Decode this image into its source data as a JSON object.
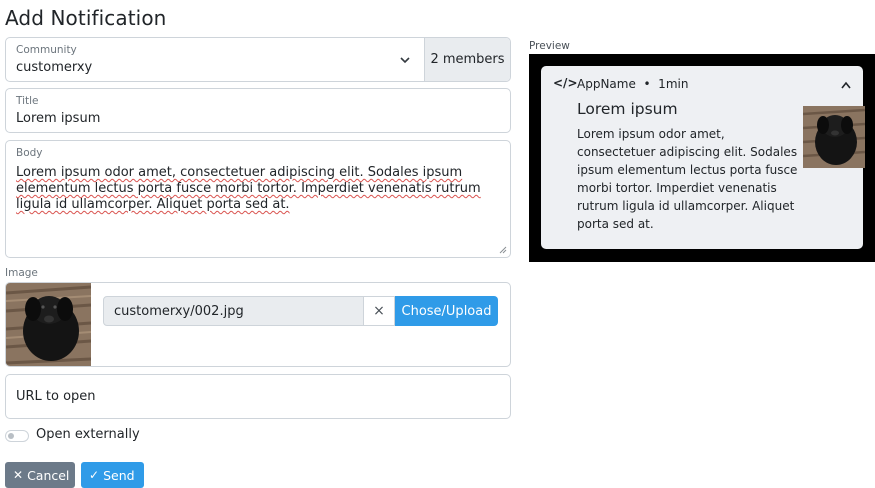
{
  "page": {
    "title": "Add Notification"
  },
  "community": {
    "label": "Community",
    "value": "customerxy",
    "members": "2 members"
  },
  "title_field": {
    "label": "Title",
    "value": "Lorem ipsum"
  },
  "body_field": {
    "label": "Body",
    "value": "Lorem ipsum odor amet, consectetuer adipiscing elit. Sodales ipsum elementum lectus porta fusce morbi tortor. Imperdiet venenatis rutrum ligula id ullamcorper. Aliquet porta sed at."
  },
  "image": {
    "label": "Image",
    "file": "customerxy/002.jpg",
    "upload_label": "Chose/Upload",
    "clear_symbol": "×"
  },
  "url_field": {
    "placeholder": "URL to open"
  },
  "open_externally": {
    "label": "Open externally",
    "checked": false
  },
  "actions": {
    "cancel_label": "Cancel",
    "send_label": "Send"
  },
  "preview": {
    "label": "Preview",
    "code_symbol": "</>",
    "app_meta": "AppName  •  1min",
    "title": "Lorem ipsum",
    "body": "Lorem ipsum odor amet, consectetuer adipiscing elit. Sodales ipsum elementum lectus porta fusce morbi tortor. Imperdiet venenatis rutrum ligula id ullamcorper. Aliquet porta sed at."
  },
  "icons": {
    "community_chevron": "chevron-down-icon",
    "cancel": "close-icon",
    "send": "check-icon",
    "preview_chevron": "chevron-up-icon"
  },
  "colors": {
    "primary": "#2f9be8",
    "secondary": "#6c7a89",
    "preview_bg": "#000000",
    "notification_bg": "#eef0f3"
  }
}
